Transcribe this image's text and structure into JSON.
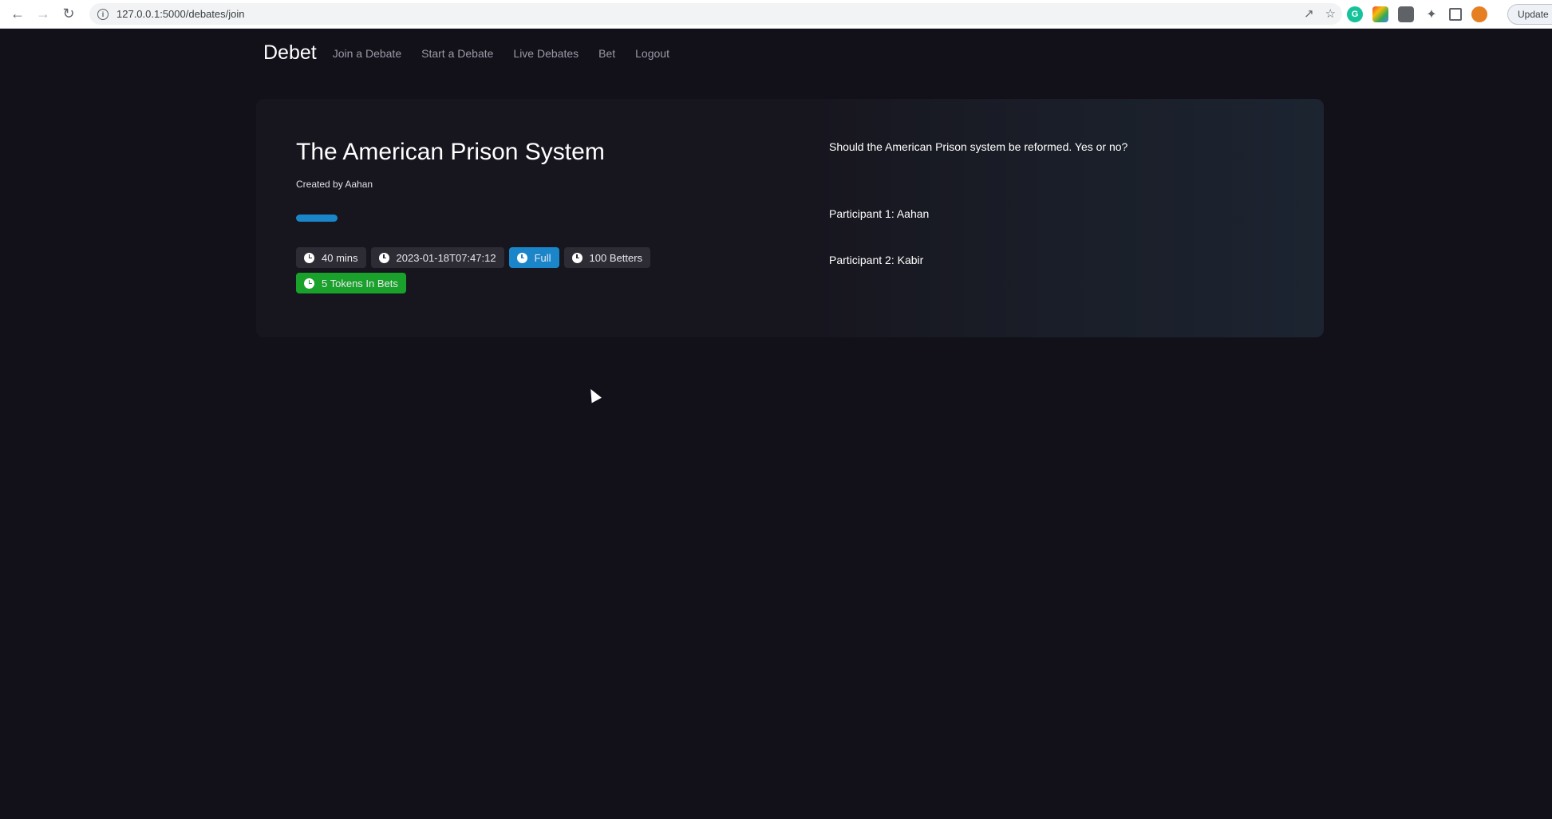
{
  "browser": {
    "url": "127.0.0.1:5000/debates/join",
    "update_label": "Update"
  },
  "nav": {
    "brand": "Debet",
    "links": [
      "Join a Debate",
      "Start a Debate",
      "Live Debates",
      "Bet",
      "Logout"
    ]
  },
  "debate": {
    "title": "The American Prison System",
    "creator": "Created by Aahan",
    "progress": 0.1,
    "badges": {
      "duration": "40 mins",
      "datetime": "2023-01-18T07:47:12",
      "status": "Full",
      "betters": "100 Betters",
      "tokens": "5 Tokens In Bets"
    },
    "question": "Should the American Prison system be reformed. Yes or no?",
    "participant1": "Participant 1: Aahan",
    "participant2": "Participant 2: Kabir"
  },
  "colors": {
    "background": "#12111a",
    "card": "#17161f",
    "badge": "#2d2c35",
    "accent_blue": "#1a86c9",
    "accent_green": "#1aa12b"
  }
}
